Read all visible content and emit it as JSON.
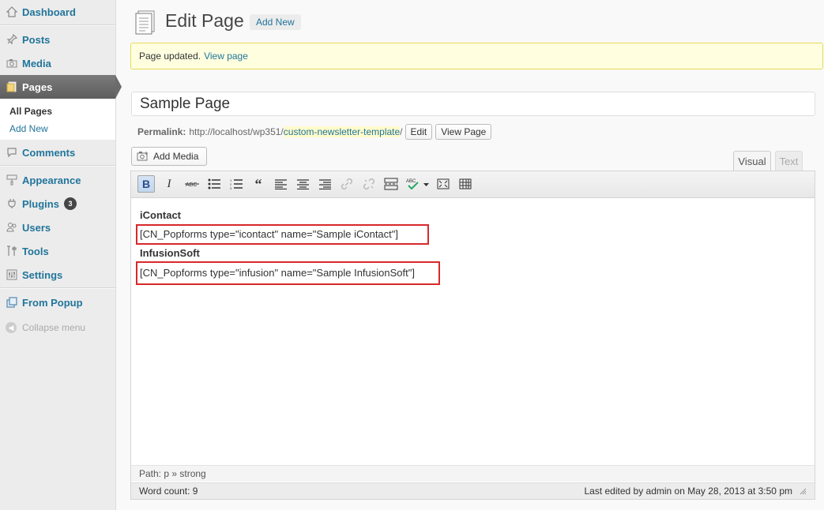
{
  "sidebar": {
    "items": [
      {
        "label": "Dashboard",
        "icon": "dashboard-icon"
      },
      {
        "label": "Posts",
        "icon": "pushpin-icon"
      },
      {
        "label": "Media",
        "icon": "camera-icon"
      },
      {
        "label": "Pages",
        "icon": "pages-icon",
        "active": true
      },
      {
        "label": "Comments",
        "icon": "comment-bubble-icon"
      },
      {
        "label": "Appearance",
        "icon": "paintbrush-icon"
      },
      {
        "label": "Plugins",
        "icon": "plug-icon",
        "badge": "3"
      },
      {
        "label": "Users",
        "icon": "users-icon"
      },
      {
        "label": "Tools",
        "icon": "tools-icon"
      },
      {
        "label": "Settings",
        "icon": "settings-icon"
      },
      {
        "label": "From Popup",
        "icon": "popup-icon"
      }
    ],
    "submenu": {
      "all_pages": "All Pages",
      "add_new": "Add New"
    },
    "collapse_label": "Collapse menu"
  },
  "header": {
    "title": "Edit Page",
    "add_new": "Add New"
  },
  "notice": {
    "text": "Page updated.",
    "link": "View page"
  },
  "post": {
    "title": "Sample Page",
    "permalink_label": "Permalink:",
    "permalink_base": "http://localhost/wp351/",
    "permalink_slug": "custom-newsletter-template",
    "permalink_trail": "/",
    "edit_label": "Edit",
    "view_label": "View Page"
  },
  "editor": {
    "add_media": "Add Media",
    "tab_visual": "Visual",
    "tab_text": "Text",
    "content": {
      "heading1": "iContact",
      "shortcode1": "[CN_Popforms type=\"icontact\" name=\"Sample iContact\"]",
      "heading2": "InfusionSoft",
      "shortcode2": "[CN_Popforms type=\"infusion\" name=\"Sample InfusionSoft\"]"
    },
    "path_label": "Path: p » strong",
    "word_count": "Word count: 9",
    "last_edited": "Last edited by admin on May 28, 2013 at 3:50 pm"
  },
  "colors": {
    "link": "#21759b",
    "notice_bg": "#ffffe0",
    "highlight_box": "#d9282b",
    "active_menu": "#6b6b6b"
  }
}
